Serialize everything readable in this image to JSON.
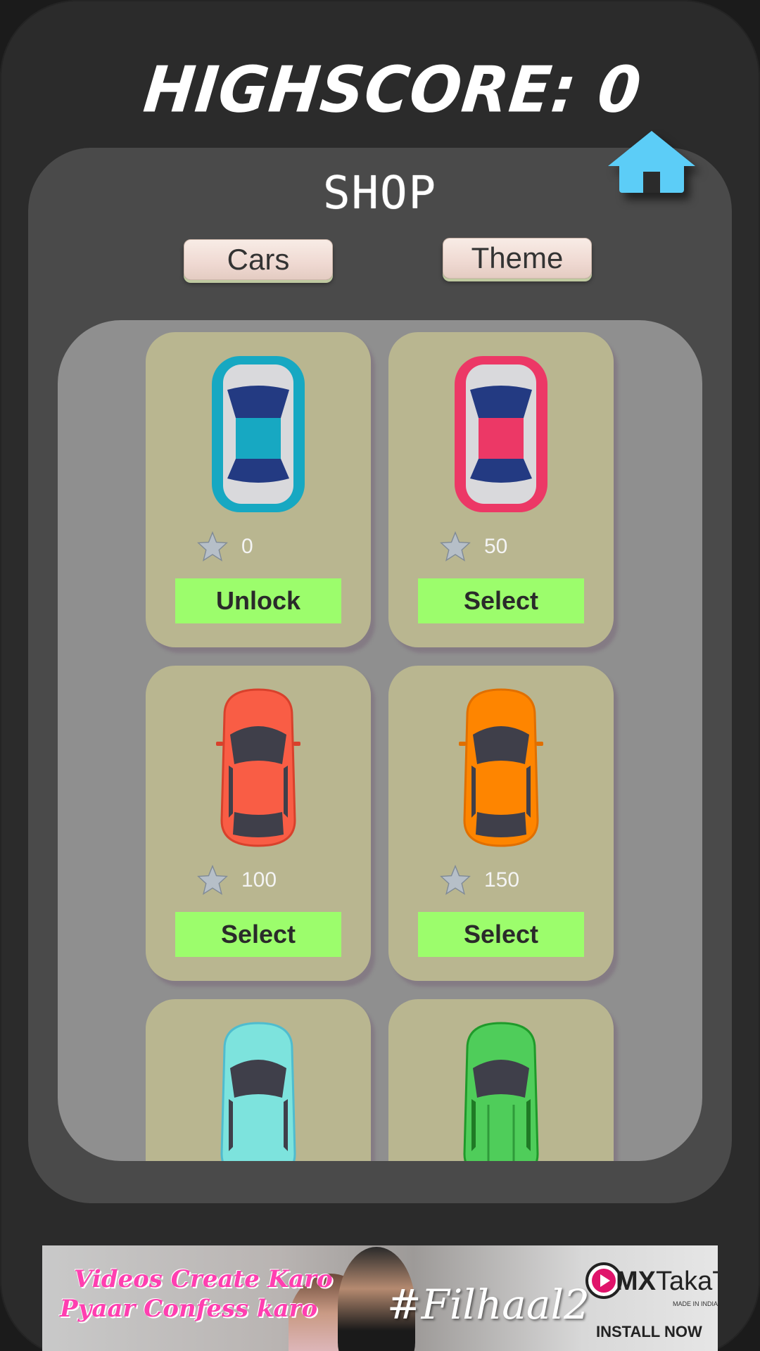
{
  "highscore": {
    "text": "HIGHSCORE: 0"
  },
  "shop": {
    "title": "SHOP"
  },
  "tabs": {
    "cars": "Cars",
    "theme": "Theme"
  },
  "icons": {
    "home": "home-icon",
    "star": "star-icon"
  },
  "colors": {
    "background": "#1b1b1b",
    "panel": "#4a4a4a",
    "grid_panel": "#8f8f8f",
    "card": "#b9b690",
    "button": "#9cfd6c",
    "home_icon": "#5ccdf7"
  },
  "cars": [
    {
      "name": "teal-sedan",
      "price": "0",
      "action": "Unlock",
      "color": "#17a8c2"
    },
    {
      "name": "pink-sedan",
      "price": "50",
      "action": "Select",
      "color": "#ec3866"
    },
    {
      "name": "red-car",
      "price": "100",
      "action": "Select",
      "color": "#f95d45"
    },
    {
      "name": "orange-car",
      "price": "150",
      "action": "Select",
      "color": "#fe8500"
    },
    {
      "name": "cyan-car",
      "price": "",
      "action": "",
      "color": "#7de3dd"
    },
    {
      "name": "green-car",
      "price": "",
      "action": "",
      "color": "#4fcd5a"
    }
  ],
  "ad": {
    "line1": "Videos Create Karo",
    "line2": "Pyaar Confess karo",
    "hashtag": "#Filhaal2",
    "brand_prefix": "MX",
    "brand_suffix": "TakaTak",
    "brand_sub": "MADE IN INDIA",
    "install": "INSTALL NOW"
  }
}
